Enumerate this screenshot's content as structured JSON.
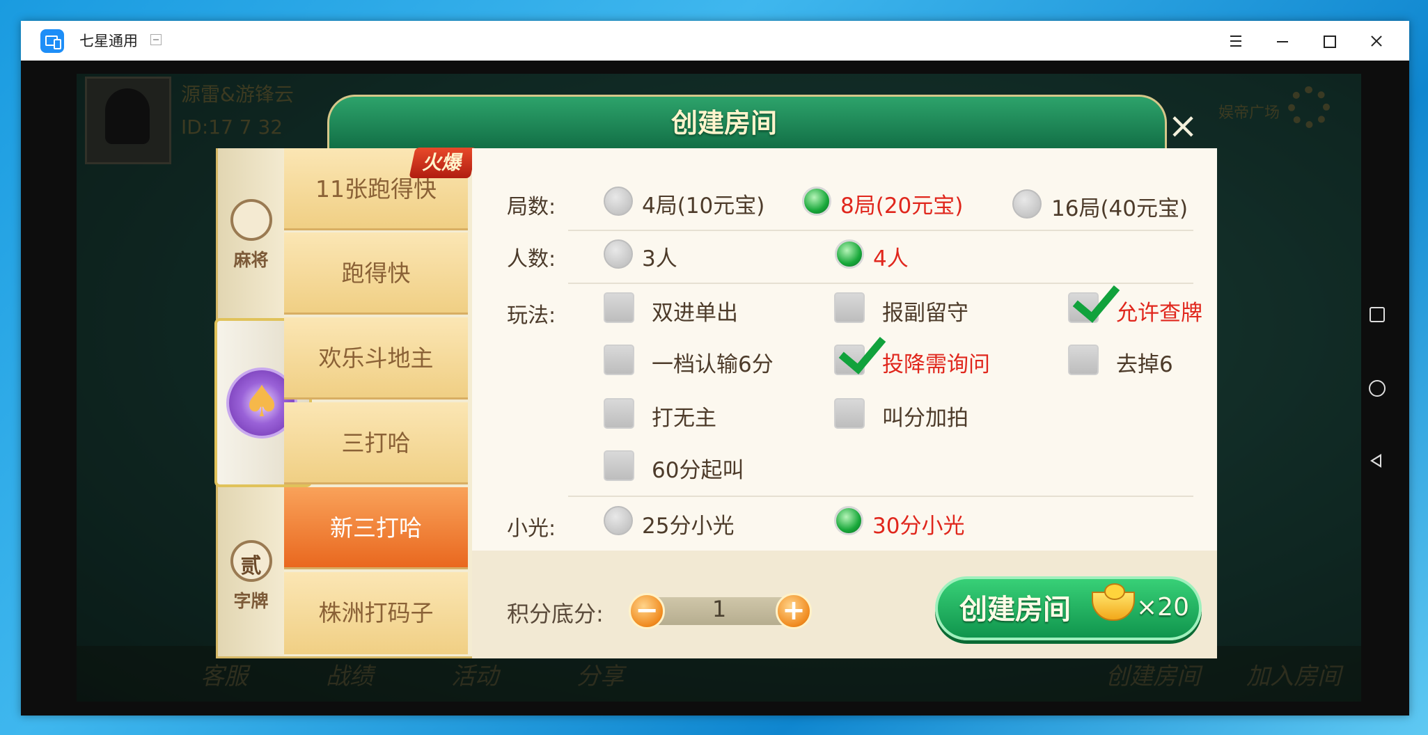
{
  "window": {
    "title": "七星通用"
  },
  "background": {
    "player_name": "源雷&游锋云",
    "player_id": "ID:17 7 32",
    "plaza_label": "娱帝广场",
    "bottom_items": [
      "客服",
      "战绩",
      "活动",
      "分享",
      "创建房间",
      "加入房间"
    ]
  },
  "dialog": {
    "title": "创建房间",
    "categories": [
      "麻将",
      "字牌"
    ],
    "category_emblems": [
      "",
      "贰"
    ],
    "games": [
      "11张跑得快",
      "跑得快",
      "欢乐斗地主",
      "三打哈",
      "新三打哈",
      "株洲打码子"
    ],
    "active_game": "新三打哈",
    "hot_badge": "火爆",
    "rounds": {
      "label": "局数:",
      "options": [
        "4局(10元宝)",
        "8局(20元宝)",
        "16局(40元宝)"
      ],
      "selected": "8局(20元宝)"
    },
    "players": {
      "label": "人数:",
      "options": [
        "3人",
        "4人"
      ],
      "selected": "4人"
    },
    "rules": {
      "label": "玩法:",
      "options": [
        {
          "text": "双进单出",
          "checked": false
        },
        {
          "text": "报副留守",
          "checked": false
        },
        {
          "text": "允许查牌",
          "checked": true
        },
        {
          "text": "一档认输6分",
          "checked": false
        },
        {
          "text": "投降需询问",
          "checked": true
        },
        {
          "text": "去掉6",
          "checked": false
        },
        {
          "text": "打无主",
          "checked": false
        },
        {
          "text": "叫分加拍",
          "checked": false
        },
        {
          "text": "60分起叫",
          "checked": false
        }
      ]
    },
    "xiaoguang": {
      "label": "小光:",
      "options": [
        "25分小光",
        "30分小光"
      ],
      "selected": "30分小光"
    },
    "score": {
      "label": "积分底分:",
      "value": "1",
      "minus": "−",
      "plus": "+"
    },
    "create_button": {
      "label": "创建房间",
      "cost": "×20"
    }
  },
  "colors": {
    "accent_green": "#10954d",
    "selected_red": "#e0261c",
    "active_tab_orange": "#e9681f"
  }
}
